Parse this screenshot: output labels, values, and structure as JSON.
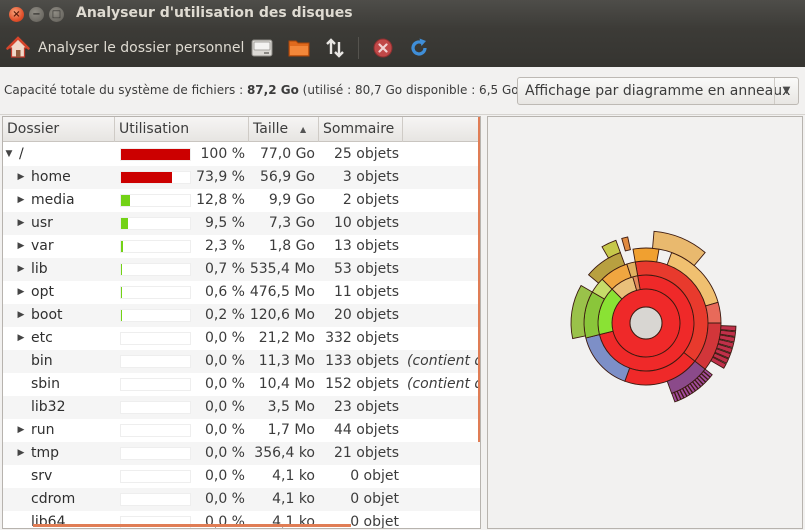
{
  "window": {
    "title": "Analyseur d'utilisation des disques",
    "close_glyph": "×",
    "min_glyph": "−",
    "max_glyph": "□"
  },
  "toolbar": {
    "home_label": "Analyser le dossier personnel",
    "icons": [
      "home-icon",
      "disk-icon",
      "folder-icon",
      "remote-icon",
      "stop-icon",
      "refresh-icon"
    ]
  },
  "info": {
    "capacity_prefix": "Capacité totale du système de fichiers : ",
    "capacity_total": "87,2 Go",
    "capacity_suffix": " (utilisé : 80,7 Go disponible : 6,5 Go )",
    "view_mode": "Affichage par diagramme en anneaux",
    "view_arrow": "▼"
  },
  "tree": {
    "headers": {
      "dossier": "Dossier",
      "utilisation": "Utilisation",
      "taille": "Taille",
      "sommaire": "Sommaire",
      "sort_arrow": "▲"
    },
    "rows": [
      {
        "name": "/",
        "expander": "▼",
        "pct": "100 %",
        "fraction": 1.0,
        "bar_color": "#cc0000",
        "size": "77,0 Go",
        "summary": "25 objets",
        "extra": "",
        "level": 0
      },
      {
        "name": "home",
        "expander": "▶",
        "pct": "73,9 %",
        "fraction": 0.739,
        "bar_color": "#cc0000",
        "size": "56,9 Go",
        "summary": "3 objets",
        "extra": "",
        "level": 1
      },
      {
        "name": "media",
        "expander": "▶",
        "pct": "12,8 %",
        "fraction": 0.128,
        "bar_color": "#73d216",
        "size": "9,9 Go",
        "summary": "2 objets",
        "extra": "",
        "level": 1
      },
      {
        "name": "usr",
        "expander": "▶",
        "pct": "9,5 %",
        "fraction": 0.095,
        "bar_color": "#73d216",
        "size": "7,3 Go",
        "summary": "10 objets",
        "extra": "",
        "level": 1
      },
      {
        "name": "var",
        "expander": "▶",
        "pct": "2,3 %",
        "fraction": 0.023,
        "bar_color": "#73d216",
        "size": "1,8 Go",
        "summary": "13 objets",
        "extra": "",
        "level": 1
      },
      {
        "name": "lib",
        "expander": "▶",
        "pct": "0,7 %",
        "fraction": 0.007,
        "bar_color": "#73d216",
        "size": "535,4 Mo",
        "summary": "53 objets",
        "extra": "",
        "level": 1
      },
      {
        "name": "opt",
        "expander": "▶",
        "pct": "0,6 %",
        "fraction": 0.006,
        "bar_color": "#73d216",
        "size": "476,5 Mo",
        "summary": "11 objets",
        "extra": "",
        "level": 1
      },
      {
        "name": "boot",
        "expander": "▶",
        "pct": "0,2 %",
        "fraction": 0.002,
        "bar_color": "#73d216",
        "size": "120,6 Mo",
        "summary": "20 objets",
        "extra": "",
        "level": 1
      },
      {
        "name": "etc",
        "expander": "▶",
        "pct": "0,0 %",
        "fraction": 0.0,
        "bar_color": "#73d216",
        "size": "21,2 Mo",
        "summary": "332 objets",
        "extra": "",
        "level": 1
      },
      {
        "name": "bin",
        "expander": "",
        "pct": "0,0 %",
        "fraction": 0.0,
        "bar_color": "#73d216",
        "size": "11,3 Mo",
        "summary": "133 objets",
        "extra": "(contient d",
        "level": 1
      },
      {
        "name": "sbin",
        "expander": "",
        "pct": "0,0 %",
        "fraction": 0.0,
        "bar_color": "#73d216",
        "size": "10,4 Mo",
        "summary": "152 objets",
        "extra": "(contient d",
        "level": 1
      },
      {
        "name": "lib32",
        "expander": "",
        "pct": "0,0 %",
        "fraction": 0.0,
        "bar_color": "#73d216",
        "size": "3,5 Mo",
        "summary": "23 objets",
        "extra": "",
        "level": 1
      },
      {
        "name": "run",
        "expander": "▶",
        "pct": "0,0 %",
        "fraction": 0.0,
        "bar_color": "#73d216",
        "size": "1,7 Mo",
        "summary": "44 objets",
        "extra": "",
        "level": 1
      },
      {
        "name": "tmp",
        "expander": "▶",
        "pct": "0,0 %",
        "fraction": 0.0,
        "bar_color": "#73d216",
        "size": "356,4 ko",
        "summary": "21 objets",
        "extra": "",
        "level": 1
      },
      {
        "name": "srv",
        "expander": "",
        "pct": "0,0 %",
        "fraction": 0.0,
        "bar_color": "#73d216",
        "size": "4,1 ko",
        "summary": "0 objet",
        "extra": "",
        "level": 1
      },
      {
        "name": "cdrom",
        "expander": "",
        "pct": "0,0 %",
        "fraction": 0.0,
        "bar_color": "#73d216",
        "size": "4,1 ko",
        "summary": "0 objet",
        "extra": "",
        "level": 1
      },
      {
        "name": "lib64",
        "expander": "",
        "pct": "0,0 %",
        "fraction": 0.0,
        "bar_color": "#73d216",
        "size": "4,1 ko",
        "summary": "0 objet",
        "extra": "",
        "level": 1
      }
    ]
  },
  "ring_colors": {
    "root": "#ef2929",
    "home": "#ef2929",
    "media": "#8ae234",
    "usr": "#e9b96e",
    "var": "#729fcf",
    "other": "#ad7fa8",
    "stroke": "#3c1a10"
  }
}
